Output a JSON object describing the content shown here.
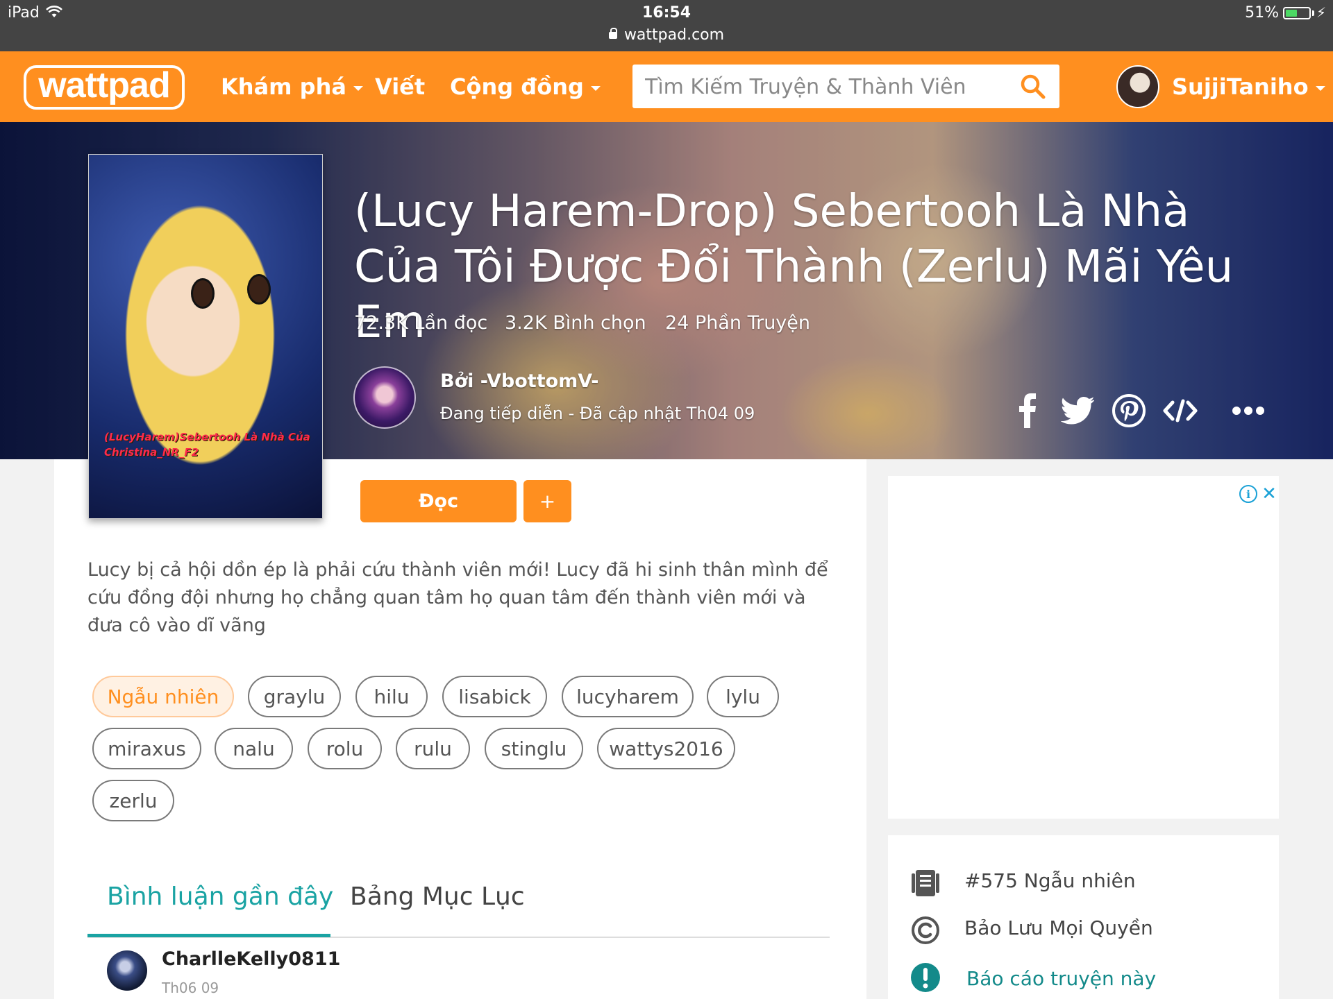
{
  "statusbar": {
    "device": "iPad",
    "time": "16:54",
    "url": "wattpad.com",
    "battery_pct_text": "51%",
    "battery_level": 0.51
  },
  "header": {
    "logo": "wattpad",
    "nav": [
      {
        "label": "Khám phá",
        "has_caret": true
      },
      {
        "label": "Viết",
        "has_caret": false
      },
      {
        "label": "Cộng đồng",
        "has_caret": true
      }
    ],
    "search_placeholder": "Tìm Kiếm Truyện & Thành Viên",
    "username": "SujjiTaniho",
    "accent_color": "#ff8f1f"
  },
  "story": {
    "title": "(Lucy Harem-Drop) Sebertooh Là Nhà Của Tôi Được Đổi Thành (Zerlu) Mãi Yêu Em",
    "cover_text": "(LucyHarem)Sebertooh Là Nhà Của Christina_NR_F2",
    "stats": {
      "reads": "72.3K Lần đọc",
      "votes": "3.2K Bình chọn",
      "parts": "24 Phần Truyện"
    },
    "author": "Bởi -VbottomV-",
    "status": "Đang tiếp diễn - Đã cập nhật Th04 09",
    "read_button": "Đọc",
    "add_button": "+",
    "description": "Lucy bị cả hội dồn ép là phải cứu thành viên mới! Lucy đã hi sinh thân mình để cứu đồng đội nhưng họ chẳng quan tâm họ quan tâm đến thành viên mới và đưa cô vào dĩ vãng",
    "tags": [
      "Ngẫu nhiên",
      "graylu",
      "hilu",
      "lisabick",
      "lucyharem",
      "lylu",
      "miraxus",
      "nalu",
      "rolu",
      "rulu",
      "stinglu",
      "wattys2016",
      "zerlu"
    ]
  },
  "share_icons": [
    "facebook-icon",
    "twitter-icon",
    "pinterest-icon",
    "embed-icon",
    "more-icon"
  ],
  "tabs": [
    {
      "label": "Bình luận gần đây",
      "active": true
    },
    {
      "label": "Bảng Mục Lục",
      "active": false
    }
  ],
  "comment": {
    "user": "CharlleKelly0811",
    "date": "Th06 09"
  },
  "sidebar": {
    "ranking": "#575 Ngẫu nhiên",
    "copyright": "Bảo Lưu Mọi Quyền",
    "report": "Báo cáo truyện này"
  }
}
